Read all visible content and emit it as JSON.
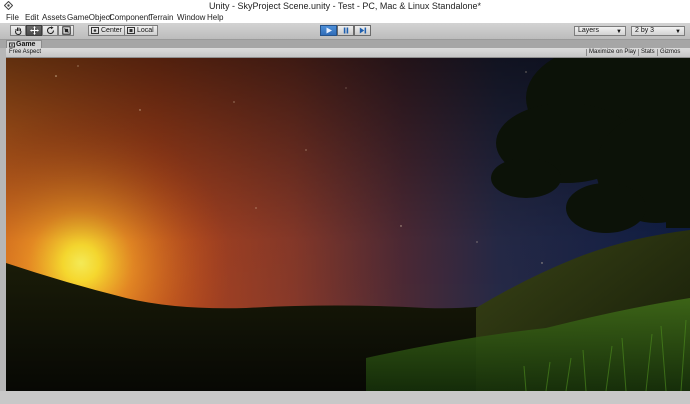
{
  "window": {
    "title": "Unity - SkyProject Scene.unity - Test - PC, Mac & Linux Standalone*",
    "icon": "unity-logo-icon"
  },
  "menu": {
    "items": [
      "File",
      "Edit",
      "Assets",
      "GameObject",
      "Component",
      "Terrain",
      "Window",
      "Help"
    ]
  },
  "toolbar": {
    "tools": [
      "hand-tool-icon",
      "move-tool-icon",
      "rotate-tool-icon",
      "scale-tool-icon"
    ],
    "active_tool": "move-tool-icon",
    "pivot_label": "Center",
    "space_label": "Local",
    "play_controls": [
      "play-icon",
      "pause-icon",
      "step-icon"
    ],
    "layers_label": "Layers",
    "layout_label": "2 by 3"
  },
  "game_view": {
    "tab_label": "Game",
    "aspect_label": "Free Aspect",
    "maximize_label": "Maximize on Play",
    "stats_label": "Stats",
    "gizmos_label": "Gizmos"
  },
  "colors": {
    "sun": "#ffe030",
    "sky_warm": "#c24a1a",
    "sky_cool": "#14244a",
    "play_active": "#2f6cb8"
  }
}
